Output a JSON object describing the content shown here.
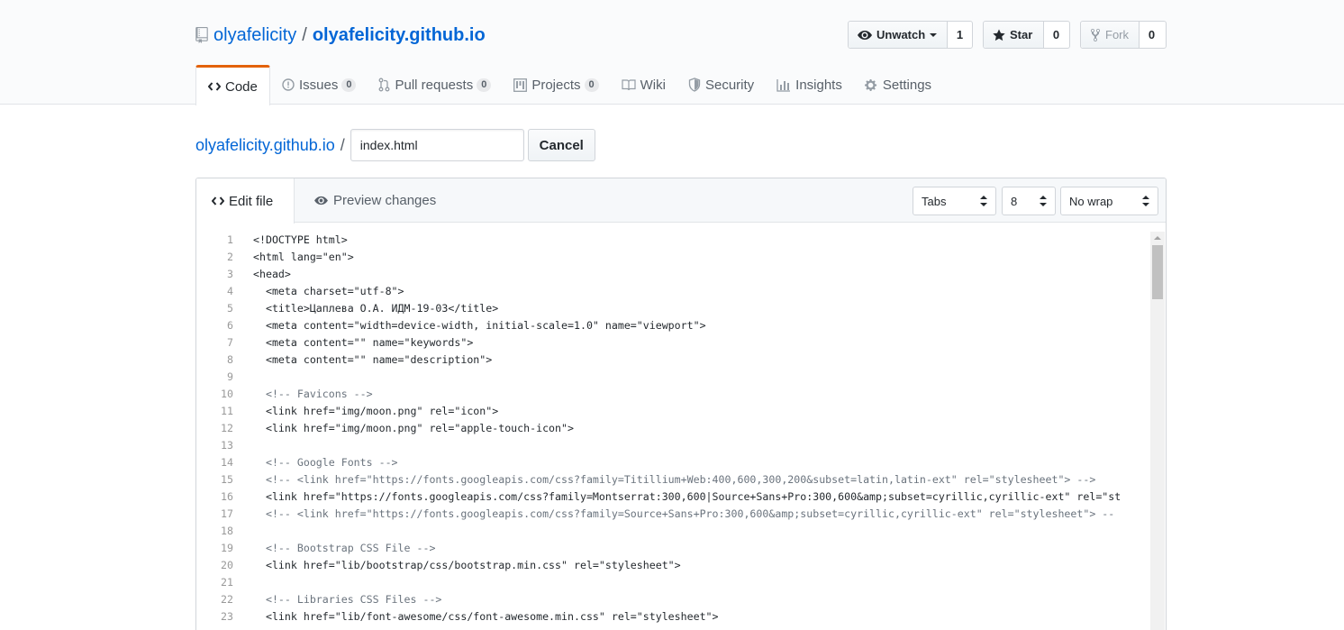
{
  "repo": {
    "owner": "olyafelicity",
    "separator": "/",
    "name": "olyafelicity.github.io"
  },
  "actions": {
    "watch_label": "Unwatch",
    "watch_count": "1",
    "star_label": "Star",
    "star_count": "0",
    "fork_label": "Fork",
    "fork_count": "0"
  },
  "tabs": [
    {
      "label": "Code",
      "icon": "code-icon",
      "counter": ""
    },
    {
      "label": "Issues",
      "icon": "issue-icon",
      "counter": "0"
    },
    {
      "label": "Pull requests",
      "icon": "pull-request-icon",
      "counter": "0"
    },
    {
      "label": "Projects",
      "icon": "project-icon",
      "counter": "0"
    },
    {
      "label": "Wiki",
      "icon": "book-icon",
      "counter": ""
    },
    {
      "label": "Security",
      "icon": "shield-icon",
      "counter": ""
    },
    {
      "label": "Insights",
      "icon": "graph-icon",
      "counter": ""
    },
    {
      "label": "Settings",
      "icon": "gear-icon",
      "counter": ""
    }
  ],
  "breadcrumb": {
    "repo_link": "olyafelicity.github.io",
    "slash": "/",
    "filename": "index.html",
    "cancel_label": "Cancel"
  },
  "editor": {
    "edit_tab": "Edit file",
    "preview_tab": "Preview changes",
    "indent_mode": "Tabs",
    "indent_size": "8",
    "wrap_mode": "No wrap"
  },
  "code_lines": [
    {
      "n": "1",
      "text": "<!DOCTYPE html>"
    },
    {
      "n": "2",
      "text": "<html lang=\"en\">"
    },
    {
      "n": "3",
      "text": "<head>"
    },
    {
      "n": "4",
      "text": "  <meta charset=\"utf-8\">"
    },
    {
      "n": "5",
      "text": "  <title>Цаплева О.А. ИДМ-19-03</title>"
    },
    {
      "n": "6",
      "text": "  <meta content=\"width=device-width, initial-scale=1.0\" name=\"viewport\">"
    },
    {
      "n": "7",
      "text": "  <meta content=\"\" name=\"keywords\">"
    },
    {
      "n": "8",
      "text": "  <meta content=\"\" name=\"description\">"
    },
    {
      "n": "9",
      "text": ""
    },
    {
      "n": "10",
      "text": "  <!-- Favicons -->"
    },
    {
      "n": "11",
      "text": "  <link href=\"img/moon.png\" rel=\"icon\">"
    },
    {
      "n": "12",
      "text": "  <link href=\"img/moon.png\" rel=\"apple-touch-icon\">"
    },
    {
      "n": "13",
      "text": ""
    },
    {
      "n": "14",
      "text": "  <!-- Google Fonts -->"
    },
    {
      "n": "15",
      "text": "  <!-- <link href=\"https://fonts.googleapis.com/css?family=Titillium+Web:400,600,300,200&subset=latin,latin-ext\" rel=\"stylesheet\"> -->"
    },
    {
      "n": "16",
      "text": "  <link href=\"https://fonts.googleapis.com/css?family=Montserrat:300,600|Source+Sans+Pro:300,600&amp;subset=cyrillic,cyrillic-ext\" rel=\"st"
    },
    {
      "n": "17",
      "text": "  <!-- <link href=\"https://fonts.googleapis.com/css?family=Source+Sans+Pro:300,600&amp;subset=cyrillic,cyrillic-ext\" rel=\"stylesheet\"> --"
    },
    {
      "n": "18",
      "text": ""
    },
    {
      "n": "19",
      "text": "  <!-- Bootstrap CSS File -->"
    },
    {
      "n": "20",
      "text": "  <link href=\"lib/bootstrap/css/bootstrap.min.css\" rel=\"stylesheet\">"
    },
    {
      "n": "21",
      "text": ""
    },
    {
      "n": "22",
      "text": "  <!-- Libraries CSS Files -->"
    },
    {
      "n": "23",
      "text": "  <link href=\"lib/font-awesome/css/font-awesome.min.css\" rel=\"stylesheet\">"
    }
  ],
  "colors": {
    "link": "#0366d6",
    "tab_accent": "#e36209",
    "comment": "#6a737d"
  }
}
